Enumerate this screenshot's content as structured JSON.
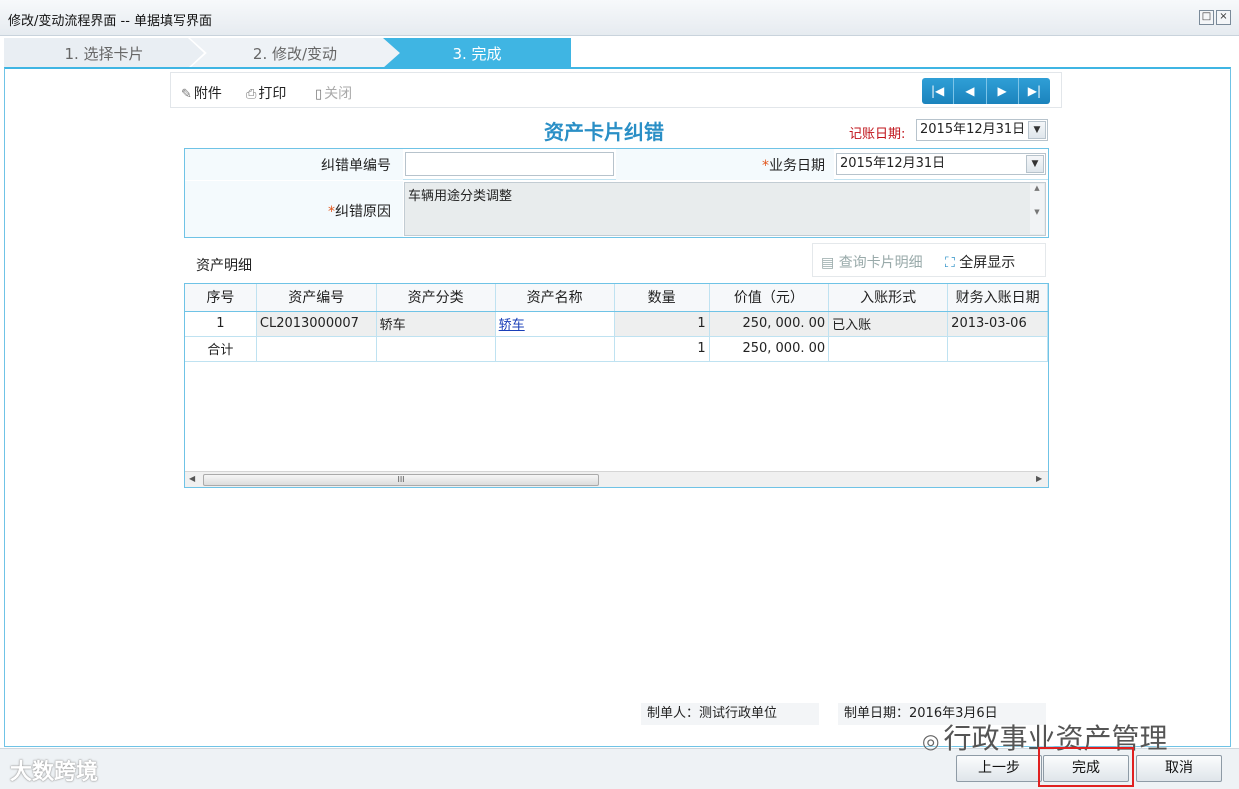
{
  "window": {
    "title": "修改/变动流程界面 -- 单据填写界面",
    "restore_label": "□",
    "close_label": "×"
  },
  "steps": [
    {
      "label": "1. 选择卡片",
      "state": "done"
    },
    {
      "label": "2. 修改/变动",
      "state": "done"
    },
    {
      "label": "3. 完成",
      "state": "active"
    }
  ],
  "toolbar": {
    "attach": "附件",
    "attach_icon": "paperclip-icon",
    "print": "打印",
    "print_icon": "printer-icon",
    "close": "关闭",
    "close_icon": "door-icon",
    "nav": [
      "|◀",
      "◀",
      "▶",
      "▶|"
    ]
  },
  "doc": {
    "title": "资产卡片纠错",
    "acct_date_label": "记账日期:",
    "acct_date_value": "2015年12月31日"
  },
  "form": {
    "correction_no_label": "纠错单编号",
    "correction_no_value": "",
    "business_date_label": "业务日期",
    "business_date_value": "2015年12月31日",
    "reason_label": "纠错原因",
    "reason_value": "车辆用途分类调整",
    "required_mark": "*"
  },
  "detail": {
    "title": "资产明细",
    "query_btn": "查询卡片明细",
    "fullscreen_btn": "全屏显示",
    "columns": [
      "序号",
      "资产编号",
      "资产分类",
      "资产名称",
      "数量",
      "价值（元）",
      "入账形式",
      "财务入账日期"
    ],
    "rows": [
      [
        "1",
        "CL2013000007",
        "轿车",
        "轿车",
        "1",
        "250, 000. 00",
        "已入账",
        "2013-03-06"
      ]
    ],
    "total": [
      "合计",
      "",
      "",
      "",
      "1",
      "250, 000. 00",
      "",
      ""
    ],
    "scroll_thumb": "III"
  },
  "meta": {
    "maker": "制单人：测试行政单位",
    "made_date": "制单日期：2016年3月6日"
  },
  "footer": {
    "prev": "上一步",
    "finish": "完成",
    "cancel": "取消"
  },
  "watermarks": {
    "left": "大数跨境",
    "right": "行政事业资产管理"
  },
  "colors": {
    "accent": "#3fb5e3",
    "required": "#e2561c",
    "highlight": "#e02020"
  }
}
